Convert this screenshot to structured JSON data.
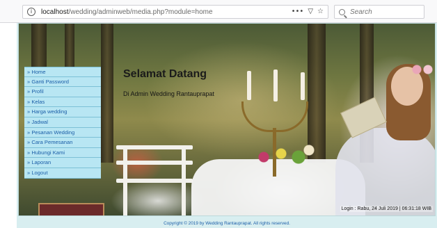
{
  "browser": {
    "url_host": "localhost",
    "url_path": "/wedding/adminweb/media.php?module=home",
    "more_actions": "•••",
    "search_placeholder": "Search"
  },
  "header": {
    "title": "Selamat Datang",
    "subtitle": "Di Admin Wedding Rantauprapat"
  },
  "sidebar": {
    "items": [
      {
        "label": "» Home"
      },
      {
        "label": "» Ganti Password"
      },
      {
        "label": "» Profil"
      },
      {
        "label": "» Kelas"
      },
      {
        "label": "» Harga wedding"
      },
      {
        "label": "» Jadwal"
      },
      {
        "label": "» Pesanan Wedding"
      },
      {
        "label": "» Cara Pemesanan"
      },
      {
        "label": "» Hubungi Kami"
      },
      {
        "label": "» Laporan"
      },
      {
        "label": "» Logout"
      }
    ]
  },
  "status": {
    "login_text": "Login : Rabu, 24 Juli 2019 | 06:31:18 WIB"
  },
  "footer": {
    "copyright": "Copyright © 2019 by Wedding Rantauprapat. All rights reserved."
  }
}
